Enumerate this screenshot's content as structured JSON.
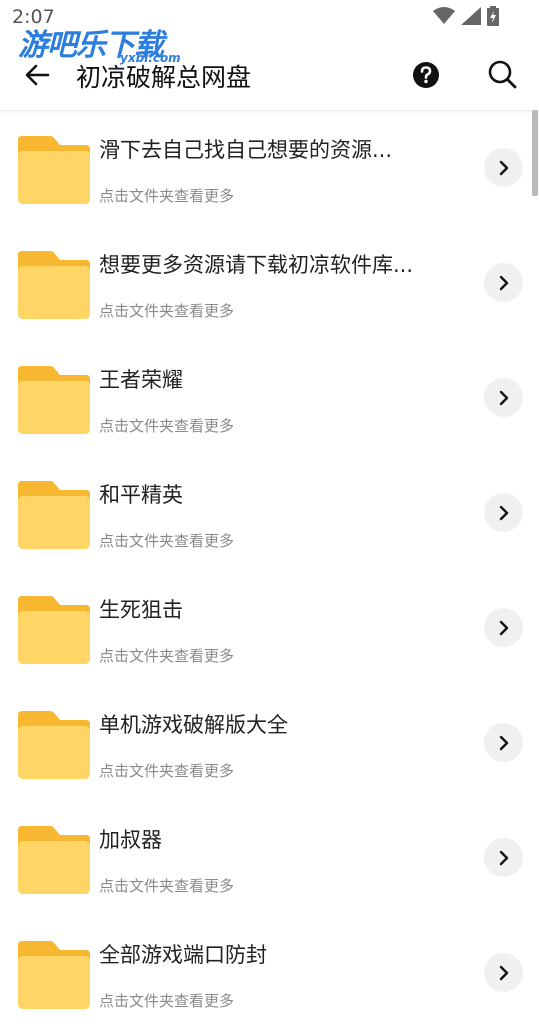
{
  "status_bar": {
    "time": "2:07"
  },
  "watermark": {
    "text": "游吧乐下载",
    "sub": "yxbl.com"
  },
  "app_bar": {
    "title": "初凉破解总网盘"
  },
  "list": {
    "items": [
      {
        "title": "滑下去自己找自己想要的资源...",
        "subtitle": "点击文件夹查看更多"
      },
      {
        "title": "想要更多资源请下载初凉软件库...",
        "subtitle": "点击文件夹查看更多"
      },
      {
        "title": "王者荣耀",
        "subtitle": "点击文件夹查看更多"
      },
      {
        "title": "和平精英",
        "subtitle": "点击文件夹查看更多"
      },
      {
        "title": "生死狙击",
        "subtitle": "点击文件夹查看更多"
      },
      {
        "title": "单机游戏破解版大全",
        "subtitle": "点击文件夹查看更多"
      },
      {
        "title": "加叔器",
        "subtitle": "点击文件夹查看更多"
      },
      {
        "title": "全部游戏端口防封",
        "subtitle": "点击文件夹查看更多"
      }
    ]
  },
  "colors": {
    "folder_back": "#f7b731",
    "folder_front": "#ffd666",
    "watermark": "#2b7de0"
  }
}
